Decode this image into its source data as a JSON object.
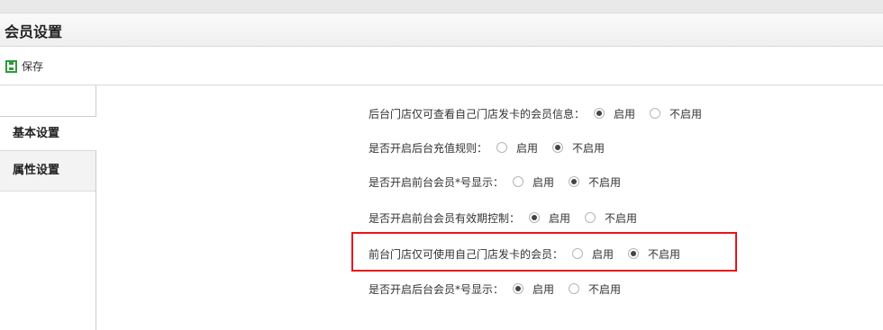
{
  "page": {
    "title": "会员设置"
  },
  "toolbar": {
    "save_icon": "save-icon",
    "save_label": "保存"
  },
  "sidebar": {
    "items": [
      {
        "label": "基本设置",
        "active": true
      },
      {
        "label": "属性设置",
        "active": false
      }
    ]
  },
  "settings": [
    {
      "label": "后台门店仅可查看自己门店发卡的会员信息：",
      "options": [
        "启用",
        "不启用"
      ],
      "selected": "启用"
    },
    {
      "label": "是否开启后台充值规则：",
      "options": [
        "启用",
        "不启用"
      ],
      "selected": "不启用"
    },
    {
      "label": "是否开启前台会员*号显示：",
      "options": [
        "启用",
        "不启用"
      ],
      "selected": "不启用"
    },
    {
      "label": "是否开启前台会员有效期控制：",
      "options": [
        "启用",
        "不启用"
      ],
      "selected": "启用"
    },
    {
      "label": "前台门店仅可使用自己门店发卡的会员：",
      "options": [
        "启用",
        "不启用"
      ],
      "selected": "不启用"
    },
    {
      "label": "是否开启后台会员*号显示：",
      "options": [
        "启用",
        "不启用"
      ],
      "selected": "启用"
    }
  ],
  "colors": {
    "accent_green": "#2e9a3a",
    "highlight_red": "#e8141a"
  }
}
